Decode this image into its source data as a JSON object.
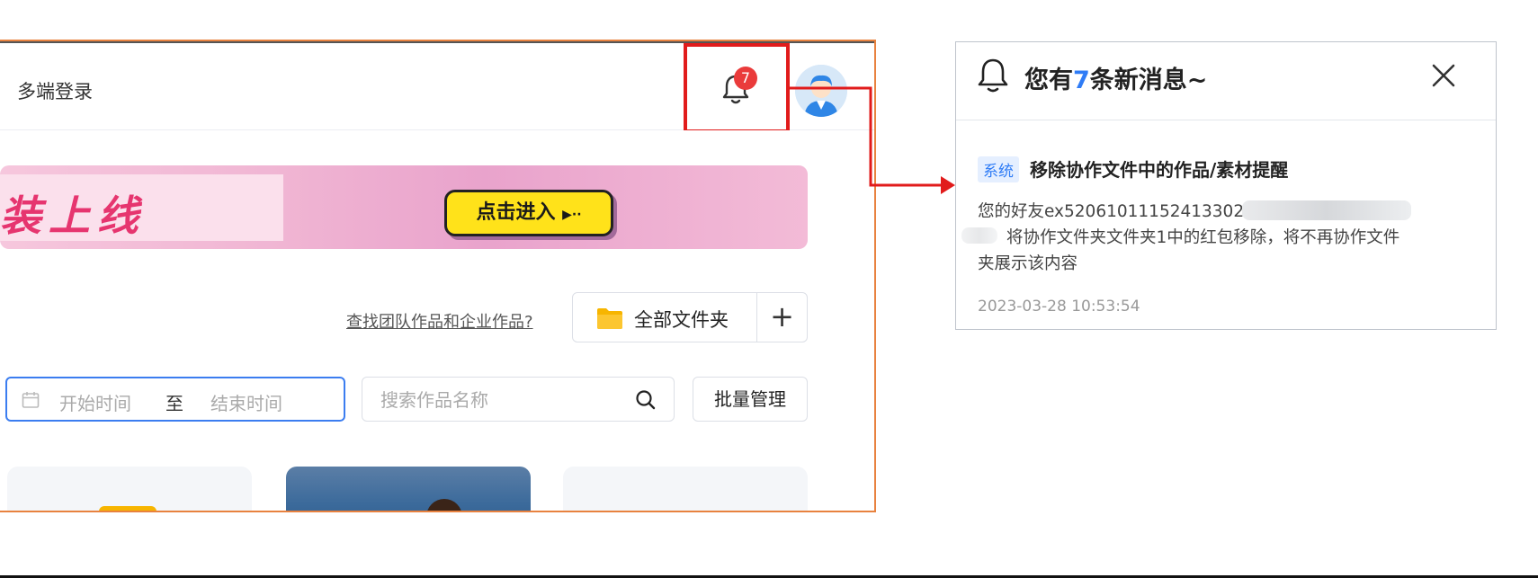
{
  "header": {
    "multi_login": "多端登录",
    "notification_count": "7"
  },
  "banner": {
    "title": "装上线",
    "button_label": "点击进入"
  },
  "toolbar": {
    "find_link": "查找团队作品和企业作品?",
    "folder_select": "全部文件夹",
    "add_label": "+",
    "date_start_placeholder": "开始时间",
    "date_separator": "至",
    "date_end_placeholder": "结束时间",
    "search_placeholder": "搜索作品名称",
    "batch_label": "批量管理"
  },
  "panel": {
    "title_prefix": "您有",
    "title_count": "7",
    "title_suffix": "条新消息~",
    "message": {
      "tag": "系统",
      "title": "移除协作文件中的作品/素材提醒",
      "body_line1": "您的好友ex52061011152413302",
      "body_line2": "将协作文件夹文件夹1中的红包移除，将不再协作文件",
      "body_line3": "夹展示该内容",
      "time": "2023-03-28 10:53:54"
    }
  },
  "colors": {
    "accent_blue": "#2f7cf6",
    "highlight_red": "#e11b1b",
    "badge_red": "#ea3b3b",
    "frame_orange": "#e8823f",
    "banner_button_yellow": "#ffe21a"
  },
  "icons": [
    "bell-icon",
    "avatar-icon",
    "folder-icon",
    "plus-icon",
    "calendar-icon",
    "search-icon",
    "close-icon",
    "play-arrows-icon"
  ]
}
